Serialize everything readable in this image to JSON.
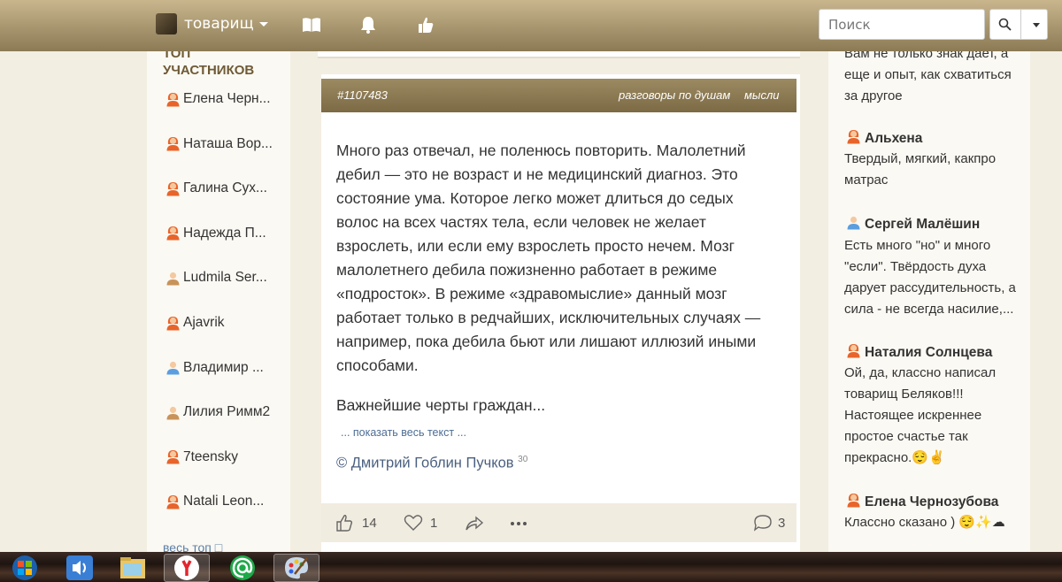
{
  "topbar": {
    "username": "товарищ",
    "search_placeholder": "Поиск"
  },
  "left_sidebar": {
    "title_line1": "топ",
    "title_line2": "участников",
    "members": [
      {
        "name": "Елена Черн...",
        "gender": "female"
      },
      {
        "name": "Наташа Вор...",
        "gender": "female"
      },
      {
        "name": "Галина Сух...",
        "gender": "female"
      },
      {
        "name": "Надежда П...",
        "gender": "female"
      },
      {
        "name": "Ludmila Ser...",
        "gender": "neutral"
      },
      {
        "name": "Ajavrik",
        "gender": "female"
      },
      {
        "name": "Владимир ...",
        "gender": "male"
      },
      {
        "name": "Лилия Римм2",
        "gender": "neutral"
      },
      {
        "name": "7teensky",
        "gender": "female"
      },
      {
        "name": "Natali Leon...",
        "gender": "female"
      }
    ],
    "all_top_link": "весь топ □"
  },
  "post": {
    "number": "#1107483",
    "tags": [
      "разговоры по душам",
      "мысли"
    ],
    "text": "Много раз отвечал, не поленюсь повторить. Малолетний дебил — это не возраст и не медицинский диагноз. Это состояние ума. Которое легко может длиться до седых волос на всех частях тела, если человек не желает взрослеть, или если ему взрослеть просто нечем. Мозг малолетнего дебила пожизненно работает в режиме «подросток». В режиме «здравомыслие» данный мозг работает только в редчайших, исключительных случаях — например, пока дебила бьют или лишают иллюзий иными способами.",
    "text_continued": "Важнейшие черты граждан...",
    "show_more": "... показать весь текст ...",
    "author": "© Дмитрий Гоблин Пучков",
    "author_count": "30",
    "likes": "14",
    "favorites": "1",
    "comments": "3"
  },
  "right_sidebar": {
    "comments": [
      {
        "author": "",
        "text": "Вам не только знак дает, а еще и опыт, как схватиться за другое"
      },
      {
        "author": "Альхена",
        "gender": "female",
        "text": "Твердый, мягкий, какпро матрас"
      },
      {
        "author": "Сергей Малёшин",
        "gender": "male",
        "text": "Есть много \"но\" и много \"если\". Твёрдость духа дарует рассудительность, а сила - не всегда насилие,..."
      },
      {
        "author": "Наталия Солнцева",
        "gender": "female",
        "text": "Ой, да, классно написал товарищ Беляков!!! Настоящее искреннее простое счастье так прекрасно.😌✌"
      },
      {
        "author": "Елена Чернозубова",
        "gender": "female",
        "text": "Классно сказано ) 😌✨☁"
      }
    ]
  }
}
